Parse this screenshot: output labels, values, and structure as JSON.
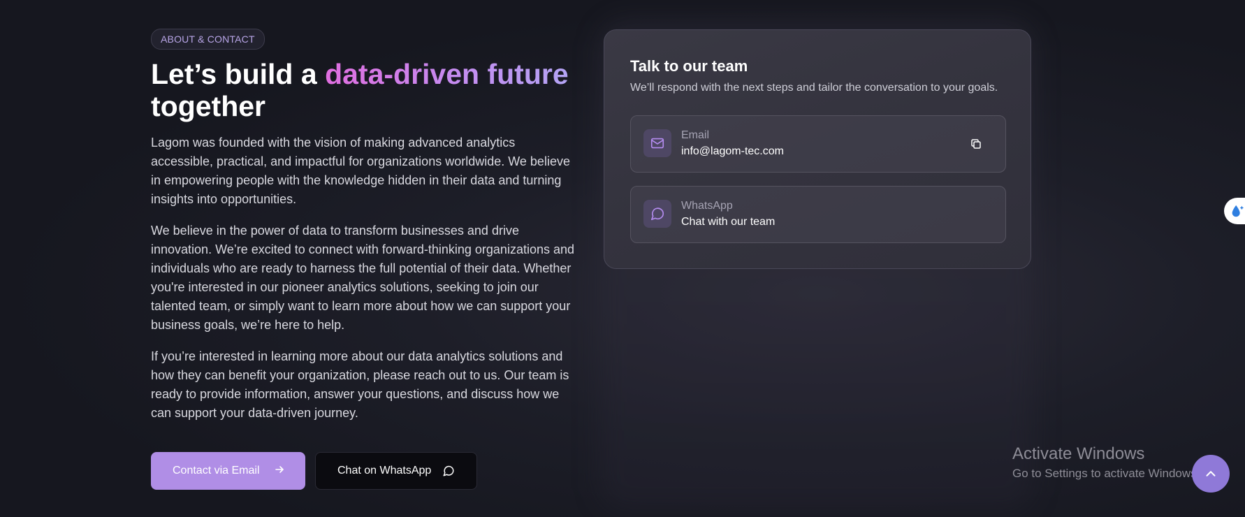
{
  "about": {
    "badge": "ABOUT & CONTACT",
    "headline_part1": "Let’s build a ",
    "headline_highlight": "data-driven future",
    "headline_part2": "together",
    "paragraphs": [
      "Lagom was founded with the vision of making advanced analytics accessible, practical, and impactful for organizations worldwide. We believe in empowering people with the knowledge hidden in their data and turning insights into opportunities.",
      "We believe in the power of data to transform businesses and drive innovation. We’re excited to connect with forward-thinking organizations and individuals who are ready to harness the full potential of their data. Whether you're interested in our pioneer analytics solutions, seeking to join our talented team, or simply want to learn more about how we can support your business goals, we’re here to help.",
      "If you’re interested in learning more about our data analytics solutions and how they can benefit your organization, please reach out to us. Our team is ready to provide information, answer your questions, and discuss how we can support your data-driven journey."
    ],
    "email_button": "Contact via Email",
    "whatsapp_button": "Chat on WhatsApp"
  },
  "card": {
    "title": "Talk to our team",
    "subtitle": "We’ll respond with the next steps and tailor the conversation to your goals.",
    "email_label": "Email",
    "email_value": "info@lagom-tec.com",
    "whatsapp_label": "WhatsApp",
    "whatsapp_value": "Chat with our team"
  },
  "overlay": {
    "activate_title": "Activate Windows",
    "activate_sub": "Go to Settings to activate Windows."
  },
  "colors": {
    "accent": "#b08ee6",
    "background": "#171821",
    "card": "#34333e"
  },
  "icons": [
    "mail-icon",
    "copy-icon",
    "chat-icon",
    "arrow-right-icon",
    "chevron-up-icon"
  ]
}
